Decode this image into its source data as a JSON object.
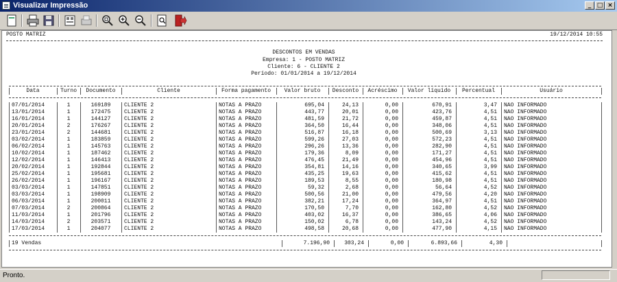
{
  "window": {
    "title": "Visualizar Impressão"
  },
  "toolbar": {
    "icons": [
      "page-setup-icon",
      "print-icon",
      "save-icon",
      "preview-icon",
      "print-to-printer-icon",
      "zoom-page-icon",
      "zoom-in-icon",
      "zoom-out-icon",
      "search-icon",
      "exit-icon"
    ]
  },
  "report": {
    "company": "POSTO MATRIZ",
    "datetime": "19/12/2014 10:55",
    "title": "DESCONTOS EM VENDAS",
    "empresa": "Empresa: 1 - POSTO MATRIZ",
    "cliente": "Cliente: 6 - CLIENTE 2",
    "periodo": "Período: 01/01/2014 a 19/12/2014",
    "columns": [
      "Data",
      "Turno",
      "Documento",
      "Cliente",
      "Forma pagamento",
      "Valor bruto",
      "Desconto",
      "Acréscimo",
      "Valor líquido",
      "Percentual",
      "Usuário"
    ],
    "rows": [
      [
        "07/01/2014",
        "1",
        "169189",
        "CLIENTE 2",
        "NOTAS A PRAZO",
        "695,04",
        "24,13",
        "0,00",
        "670,91",
        "3,47",
        "NÃO INFORMADO"
      ],
      [
        "13/01/2014",
        "1",
        "172475",
        "CLIENTE 2",
        "NOTAS A PRAZO",
        "443,77",
        "20,01",
        "0,00",
        "423,76",
        "4,51",
        "NÃO INFORMADO"
      ],
      [
        "16/01/2014",
        "1",
        "144127",
        "CLIENTE 2",
        "NOTAS A PRAZO",
        "481,59",
        "21,72",
        "0,00",
        "459,87",
        "4,51",
        "NÃO INFORMADO"
      ],
      [
        "20/01/2014",
        "2",
        "176267",
        "CLIENTE 2",
        "NOTAS A PRAZO",
        "364,50",
        "16,44",
        "0,00",
        "348,06",
        "4,51",
        "NÃO INFORMADO"
      ],
      [
        "23/01/2014",
        "2",
        "144681",
        "CLIENTE 2",
        "NOTAS A PRAZO",
        "516,87",
        "16,18",
        "0,00",
        "500,69",
        "3,13",
        "NÃO INFORMADO"
      ],
      [
        "03/02/2014",
        "1",
        "183859",
        "CLIENTE 2",
        "NOTAS A PRAZO",
        "599,26",
        "27,03",
        "0,00",
        "572,23",
        "4,51",
        "NÃO INFORMADO"
      ],
      [
        "06/02/2014",
        "1",
        "145763",
        "CLIENTE 2",
        "NOTAS A PRAZO",
        "296,26",
        "13,36",
        "0,00",
        "282,90",
        "4,51",
        "NÃO INFORMADO"
      ],
      [
        "10/02/2014",
        "1",
        "187462",
        "CLIENTE 2",
        "NOTAS A PRAZO",
        "179,36",
        "8,09",
        "0,00",
        "171,27",
        "4,51",
        "NÃO INFORMADO"
      ],
      [
        "12/02/2014",
        "1",
        "146413",
        "CLIENTE 2",
        "NOTAS A PRAZO",
        "476,45",
        "21,49",
        "0,00",
        "454,96",
        "4,51",
        "NÃO INFORMADO"
      ],
      [
        "20/02/2014",
        "1",
        "192844",
        "CLIENTE 2",
        "NOTAS A PRAZO",
        "354,81",
        "14,16",
        "0,00",
        "340,65",
        "3,99",
        "NÃO INFORMADO"
      ],
      [
        "25/02/2014",
        "1",
        "195681",
        "CLIENTE 2",
        "NOTAS A PRAZO",
        "435,25",
        "19,63",
        "0,00",
        "415,62",
        "4,51",
        "NÃO INFORMADO"
      ],
      [
        "26/02/2014",
        "1",
        "196167",
        "CLIENTE 2",
        "NOTAS A PRAZO",
        "189,53",
        "8,55",
        "0,00",
        "180,98",
        "4,51",
        "NÃO INFORMADO"
      ],
      [
        "03/03/2014",
        "1",
        "147851",
        "CLIENTE 2",
        "NOTAS A PRAZO",
        "59,32",
        "2,68",
        "0,00",
        "56,64",
        "4,52",
        "NÃO INFORMADO"
      ],
      [
        "03/03/2014",
        "1",
        "198909",
        "CLIENTE 2",
        "NOTAS A PRAZO",
        "500,56",
        "21,00",
        "0,00",
        "479,56",
        "4,20",
        "NÃO INFORMADO"
      ],
      [
        "06/03/2014",
        "1",
        "200011",
        "CLIENTE 2",
        "NOTAS A PRAZO",
        "382,21",
        "17,24",
        "0,00",
        "364,97",
        "4,51",
        "NÃO INFORMADO"
      ],
      [
        "07/03/2014",
        "2",
        "200864",
        "CLIENTE 2",
        "NOTAS A PRAZO",
        "170,50",
        "7,70",
        "0,00",
        "162,80",
        "4,52",
        "NÃO INFORMADO"
      ],
      [
        "11/03/2014",
        "1",
        "201796",
        "CLIENTE 2",
        "NOTAS A PRAZO",
        "403,02",
        "16,37",
        "0,00",
        "386,65",
        "4,06",
        "NÃO INFORMADO"
      ],
      [
        "14/03/2014",
        "2",
        "203571",
        "CLIENTE 2",
        "NOTAS A PRAZO",
        "150,02",
        "6,78",
        "0,00",
        "143,24",
        "4,52",
        "NÃO INFORMADO"
      ],
      [
        "17/03/2014",
        "1",
        "204077",
        "CLIENTE 2",
        "NOTAS A PRAZO",
        "498,58",
        "20,68",
        "0,00",
        "477,90",
        "4,15",
        "NÃO INFORMADO"
      ]
    ],
    "total": {
      "label": "19 Vendas",
      "valor_bruto": "7.196,90",
      "desconto": "303,24",
      "acrescimo": "0,00",
      "valor_liquido": "6.893,66",
      "percentual": "4,30"
    }
  },
  "status": {
    "text": "Pronto."
  }
}
